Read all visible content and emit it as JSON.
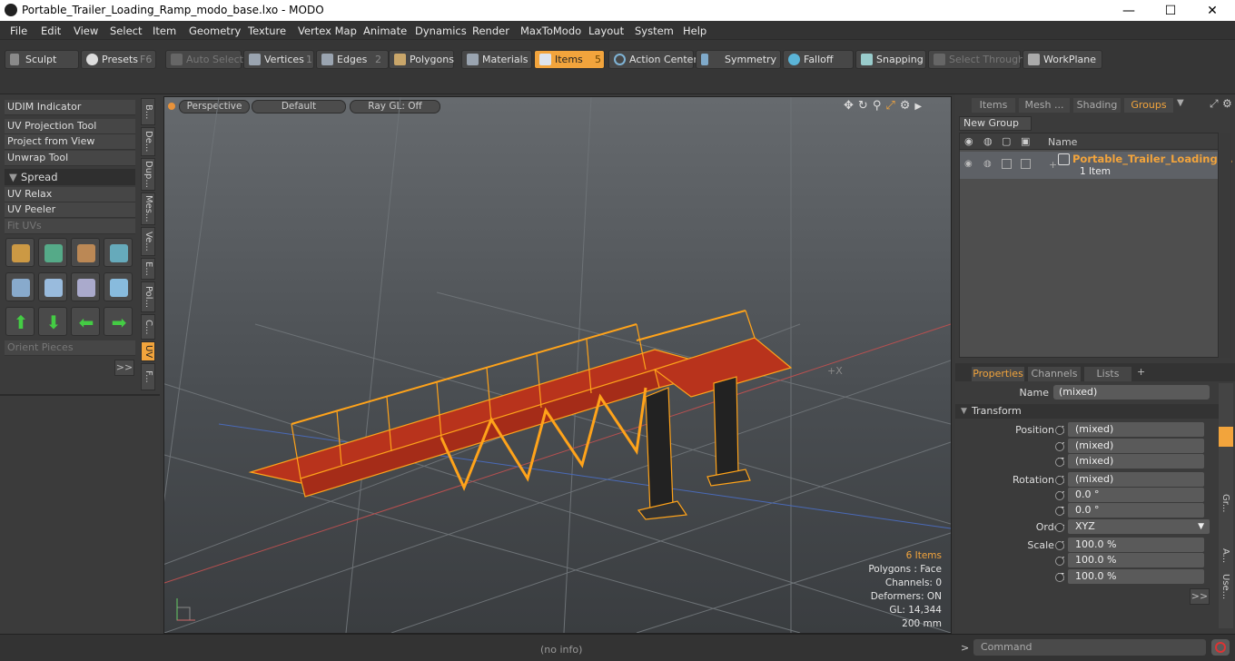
{
  "window": {
    "title": "Portable_Trailer_Loading_Ramp_modo_base.lxo - MODO",
    "min": "—",
    "max": "☐",
    "close": "✕"
  },
  "menu": [
    "File",
    "Edit",
    "View",
    "Select",
    "Item",
    "Geometry",
    "Texture",
    "Vertex Map",
    "Animate",
    "Dynamics",
    "Render",
    "MaxToModo",
    "Layout",
    "System",
    "Help"
  ],
  "toolbar": {
    "sculpt": "Sculpt",
    "presets": "Presets",
    "presets_key": "F6",
    "auto_select": "Auto Select",
    "vertices": "Vertices",
    "vertices_num": "1",
    "edges": "Edges",
    "edges_num": "2",
    "polygons": "Polygons",
    "materials": "Materials",
    "items": "Items",
    "items_num": "5",
    "action_center": "Action Center",
    "symmetry": "Symmetry",
    "falloff": "Falloff",
    "snapping": "Snapping",
    "select_through": "Select Through",
    "workplane": "WorkPlane"
  },
  "left_panel": {
    "items": [
      "UDIM Indicator",
      "UV Projection Tool",
      "Project from View",
      "Unwrap Tool"
    ],
    "spread_header": "Spread",
    "items2": [
      "UV Relax",
      "UV Peeler",
      "Fit UVs"
    ],
    "orient": "Orient Pieces",
    "more": ">>",
    "vtabs": [
      "B...",
      "De...",
      "Dup...",
      "Mes...",
      "Ve...",
      "E...",
      "Pol...",
      "C...",
      "UV",
      "F..."
    ]
  },
  "viewport": {
    "perspective": "Perspective",
    "default": "Default",
    "raygl": "Ray GL: Off",
    "stats": {
      "items": "6 Items",
      "polygons": "Polygons : Face",
      "channels": "Channels: 0",
      "deformers": "Deformers: ON",
      "gl": "GL: 14,344",
      "size": "200 mm"
    }
  },
  "right_panel": {
    "tabs": [
      "Items",
      "Mesh ...",
      "Shading",
      "Groups"
    ],
    "new_group": "New Group",
    "col_name": "Name",
    "group_name": "Portable_Trailer_Loading ...",
    "group_count": "1 Item",
    "prop_tabs": [
      "Properties",
      "Channels",
      "Lists"
    ],
    "name_label": "Name",
    "name_value": "(mixed)",
    "transform": "Transform",
    "rows": [
      {
        "label": "Position X",
        "value": "(mixed)"
      },
      {
        "label": "Y",
        "value": "(mixed)"
      },
      {
        "label": "Z",
        "value": "(mixed)"
      },
      {
        "label": "Rotation X",
        "value": "(mixed)"
      },
      {
        "label": "Y",
        "value": "0.0 °"
      },
      {
        "label": "Z",
        "value": "0.0 °"
      },
      {
        "label": "Order",
        "value": "XYZ"
      },
      {
        "label": "Scale X",
        "value": "100.0 %"
      },
      {
        "label": "Y",
        "value": "100.0 %"
      },
      {
        "label": "Z",
        "value": "100.0 %"
      }
    ],
    "more": ">>",
    "side_tabs": [
      "Gr...",
      "A...",
      "Use..."
    ]
  },
  "status": {
    "info": "(no info)",
    "command": "Command",
    "prompt": ">"
  },
  "colors": {
    "accent": "#f2a43c",
    "model_fill": "#b8331c",
    "wire": "#ffa31a"
  }
}
